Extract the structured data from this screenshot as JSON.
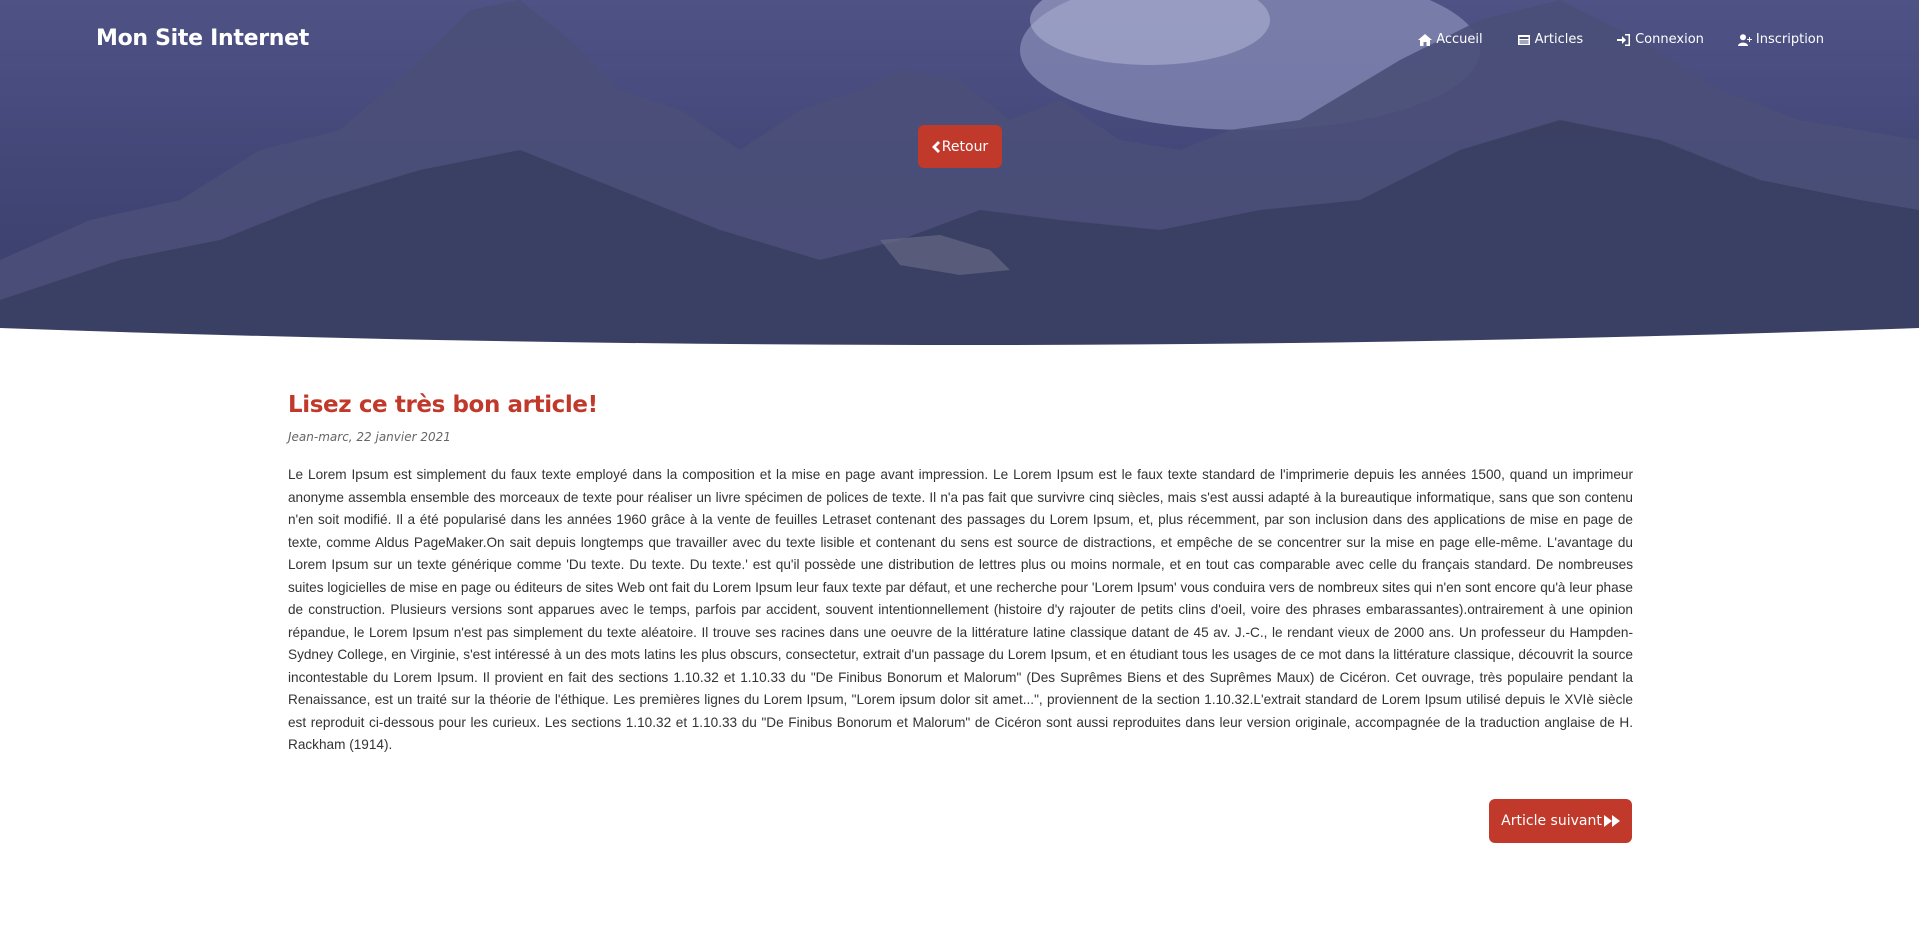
{
  "header": {
    "brand": "Mon Site Internet",
    "nav": [
      {
        "label": "Accueil",
        "icon": "home-icon"
      },
      {
        "label": "Articles",
        "icon": "newspaper-icon"
      },
      {
        "label": "Connexion",
        "icon": "sign-in-icon"
      },
      {
        "label": "Inscription",
        "icon": "user-plus-icon"
      }
    ],
    "back_button": "Retour"
  },
  "article": {
    "title": "Lisez ce très bon article!",
    "byline": "Jean-marc, 22 janvier 2021",
    "body": "Le Lorem Ipsum est simplement du faux texte employé dans la composition et la mise en page avant impression. Le Lorem Ipsum est le faux texte standard de l'imprimerie depuis les années 1500, quand un imprimeur anonyme assembla ensemble des morceaux de texte pour réaliser un livre spécimen de polices de texte. Il n'a pas fait que survivre cinq siècles, mais s'est aussi adapté à la bureautique informatique, sans que son contenu n'en soit modifié. Il a été popularisé dans les années 1960 grâce à la vente de feuilles Letraset contenant des passages du Lorem Ipsum, et, plus récemment, par son inclusion dans des applications de mise en page de texte, comme Aldus PageMaker.On sait depuis longtemps que travailler avec du texte lisible et contenant du sens est source de distractions, et empêche de se concentrer sur la mise en page elle-même. L'avantage du Lorem Ipsum sur un texte générique comme 'Du texte. Du texte. Du texte.' est qu'il possède une distribution de lettres plus ou moins normale, et en tout cas comparable avec celle du français standard. De nombreuses suites logicielles de mise en page ou éditeurs de sites Web ont fait du Lorem Ipsum leur faux texte par défaut, et une recherche pour 'Lorem Ipsum' vous conduira vers de nombreux sites qui n'en sont encore qu'à leur phase de construction. Plusieurs versions sont apparues avec le temps, parfois par accident, souvent intentionnellement (histoire d'y rajouter de petits clins d'oeil, voire des phrases embarassantes).ontrairement à une opinion répandue, le Lorem Ipsum n'est pas simplement du texte aléatoire. Il trouve ses racines dans une oeuvre de la littérature latine classique datant de 45 av. J.-C., le rendant vieux de 2000 ans. Un professeur du Hampden-Sydney College, en Virginie, s'est intéressé à un des mots latins les plus obscurs, consectetur, extrait d'un passage du Lorem Ipsum, et en étudiant tous les usages de ce mot dans la littérature classique, découvrit la source incontestable du Lorem Ipsum. Il provient en fait des sections 1.10.32 et 1.10.33 du \"De Finibus Bonorum et Malorum\" (Des Suprêmes Biens et des Suprêmes Maux) de Cicéron. Cet ouvrage, très populaire pendant la Renaissance, est un traité sur la théorie de l'éthique. Les premières lignes du Lorem Ipsum, \"Lorem ipsum dolor sit amet...\", proviennent de la section 1.10.32.L'extrait standard de Lorem Ipsum utilisé depuis le XVIè siècle est reproduit ci-dessous pour les curieux. Les sections 1.10.32 et 1.10.33 du \"De Finibus Bonorum et Malorum\" de Cicéron sont aussi reproduites dans leur version originale, accompagnée de la traduction anglaise de H. Rackham (1914).",
    "next_button": "Article suivant"
  },
  "colors": {
    "accent": "#c0392b",
    "hero_overlay": "#3e4076"
  }
}
